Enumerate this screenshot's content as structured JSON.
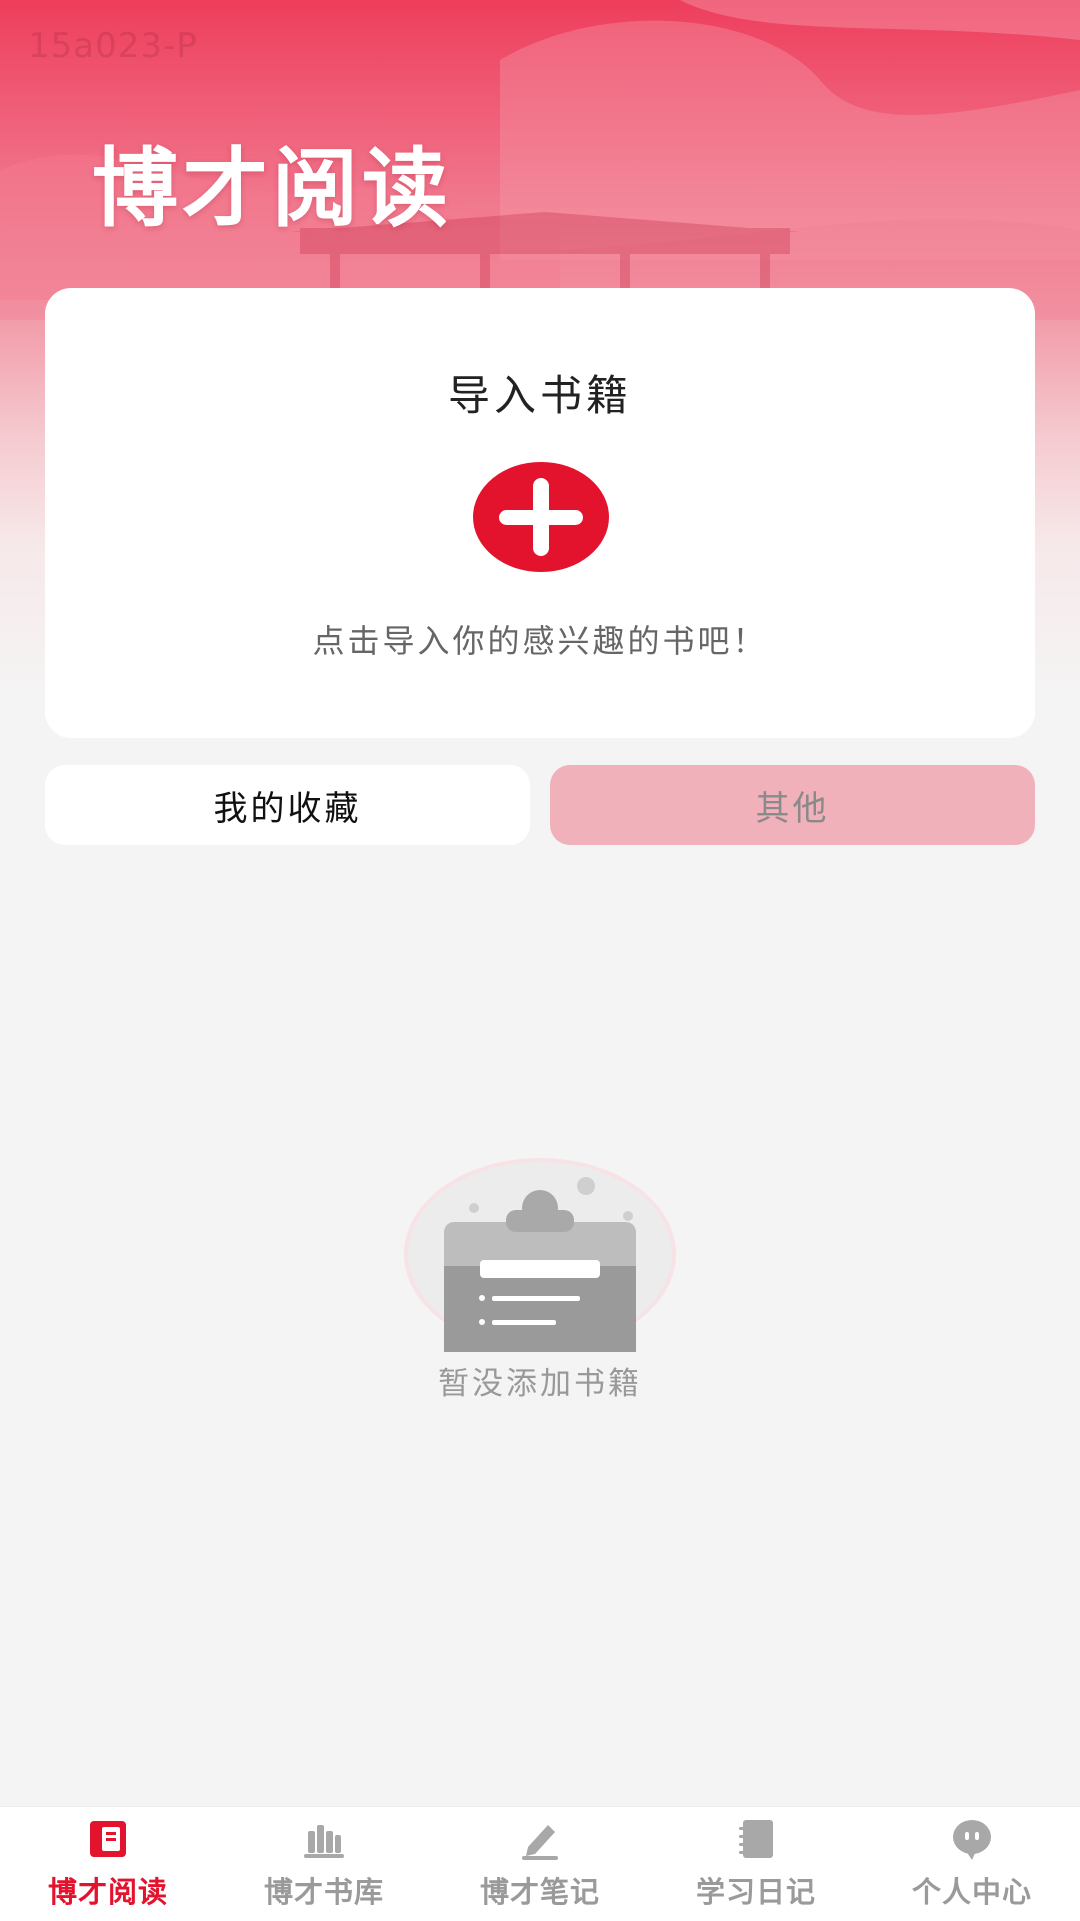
{
  "status_watermark": "15a023-P",
  "header": {
    "title": "博才阅读"
  },
  "import_card": {
    "title": "导入书籍",
    "add_icon": "plus-circle-icon",
    "hint": "点击导入你的感兴趣的书吧！"
  },
  "tabs": [
    {
      "label": "我的收藏",
      "selected": true
    },
    {
      "label": "其他",
      "selected": false
    }
  ],
  "empty_state": {
    "icon": "empty-clipboard-icon",
    "text": "暂没添加书籍"
  },
  "bottom_nav": [
    {
      "label": "博才阅读",
      "icon": "book-icon",
      "active": true
    },
    {
      "label": "博才书库",
      "icon": "bookshelf-icon",
      "active": false
    },
    {
      "label": "博才笔记",
      "icon": "pen-icon",
      "active": false
    },
    {
      "label": "学习日记",
      "icon": "notebook-icon",
      "active": false
    },
    {
      "label": "个人中心",
      "icon": "chat-bubble-icon",
      "active": false
    }
  ],
  "colors": {
    "accent": "#e3132e",
    "hero_top": "#ee3e5c",
    "tab_inactive_bg": "#f0b1bb",
    "nav_inactive": "#9a9a9a"
  }
}
